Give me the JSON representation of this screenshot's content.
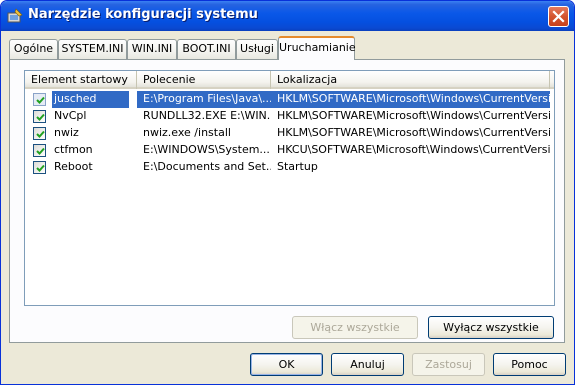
{
  "window": {
    "title": "Narzędzie konfiguracji systemu",
    "app_icon": "msconfig-icon",
    "close_icon": "close-icon"
  },
  "tabs": [
    {
      "label": "Ogólne",
      "active": false
    },
    {
      "label": "SYSTEM.INI",
      "active": false
    },
    {
      "label": "WIN.INI",
      "active": false
    },
    {
      "label": "BOOT.INI",
      "active": false
    },
    {
      "label": "Usługi",
      "active": false
    },
    {
      "label": "Uruchamianie",
      "active": true
    }
  ],
  "startup_list": {
    "columns": [
      "Element startowy",
      "Polecenie",
      "Lokalizacja"
    ],
    "rows": [
      {
        "checked": true,
        "name": "jusched",
        "command": "E:\\Program Files\\Java\\...",
        "location": "HKLM\\SOFTWARE\\Microsoft\\Windows\\CurrentVersio...",
        "selected": true
      },
      {
        "checked": true,
        "name": "NvCpl",
        "command": "RUNDLL32.EXE E:\\WIN...",
        "location": "HKLM\\SOFTWARE\\Microsoft\\Windows\\CurrentVersio...",
        "selected": false
      },
      {
        "checked": true,
        "name": "nwiz",
        "command": "nwiz.exe /install",
        "location": "HKLM\\SOFTWARE\\Microsoft\\Windows\\CurrentVersio...",
        "selected": false
      },
      {
        "checked": true,
        "name": "ctfmon",
        "command": "E:\\WINDOWS\\System...",
        "location": "HKCU\\SOFTWARE\\Microsoft\\Windows\\CurrentVersio...",
        "selected": false
      },
      {
        "checked": true,
        "name": "Reboot",
        "command": "E:\\Documents and Set...",
        "location": "Startup",
        "selected": false
      }
    ]
  },
  "panel_buttons": {
    "enable_all": "Włącz wszystkie",
    "disable_all": "Wyłącz wszystkie"
  },
  "dialog_buttons": {
    "ok": "OK",
    "cancel": "Anuluj",
    "apply": "Zastosuj",
    "help": "Pomoc"
  },
  "colors": {
    "titlebar": "#0a58e8",
    "selection": "#316ac5",
    "active_tab_accent": "#e68b2c",
    "dialog_bg": "#ece9d8"
  }
}
